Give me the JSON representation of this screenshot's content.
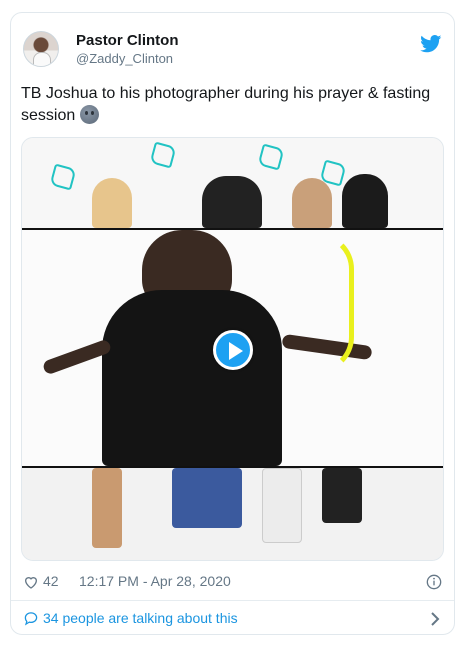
{
  "tweet": {
    "author_name": "Pastor Clinton",
    "author_handle": "@Zaddy_Clinton",
    "text": "TB Joshua to his photographer during his prayer & fasting session",
    "emoji": "neutral-face-emoji",
    "likes": "42",
    "timestamp": "12:17 PM - Apr 28, 2020",
    "talking": "34 people are talking about this"
  },
  "icons": {
    "brand": "twitter-bird-icon",
    "like": "heart-icon",
    "info": "info-icon",
    "reply": "chat-bubble-icon",
    "chevron": "chevron-right-icon",
    "play": "play-icon"
  },
  "colors": {
    "brand_blue": "#1da1f2",
    "link_blue": "#1b95e0",
    "muted": "#657786",
    "text": "#14171a"
  }
}
